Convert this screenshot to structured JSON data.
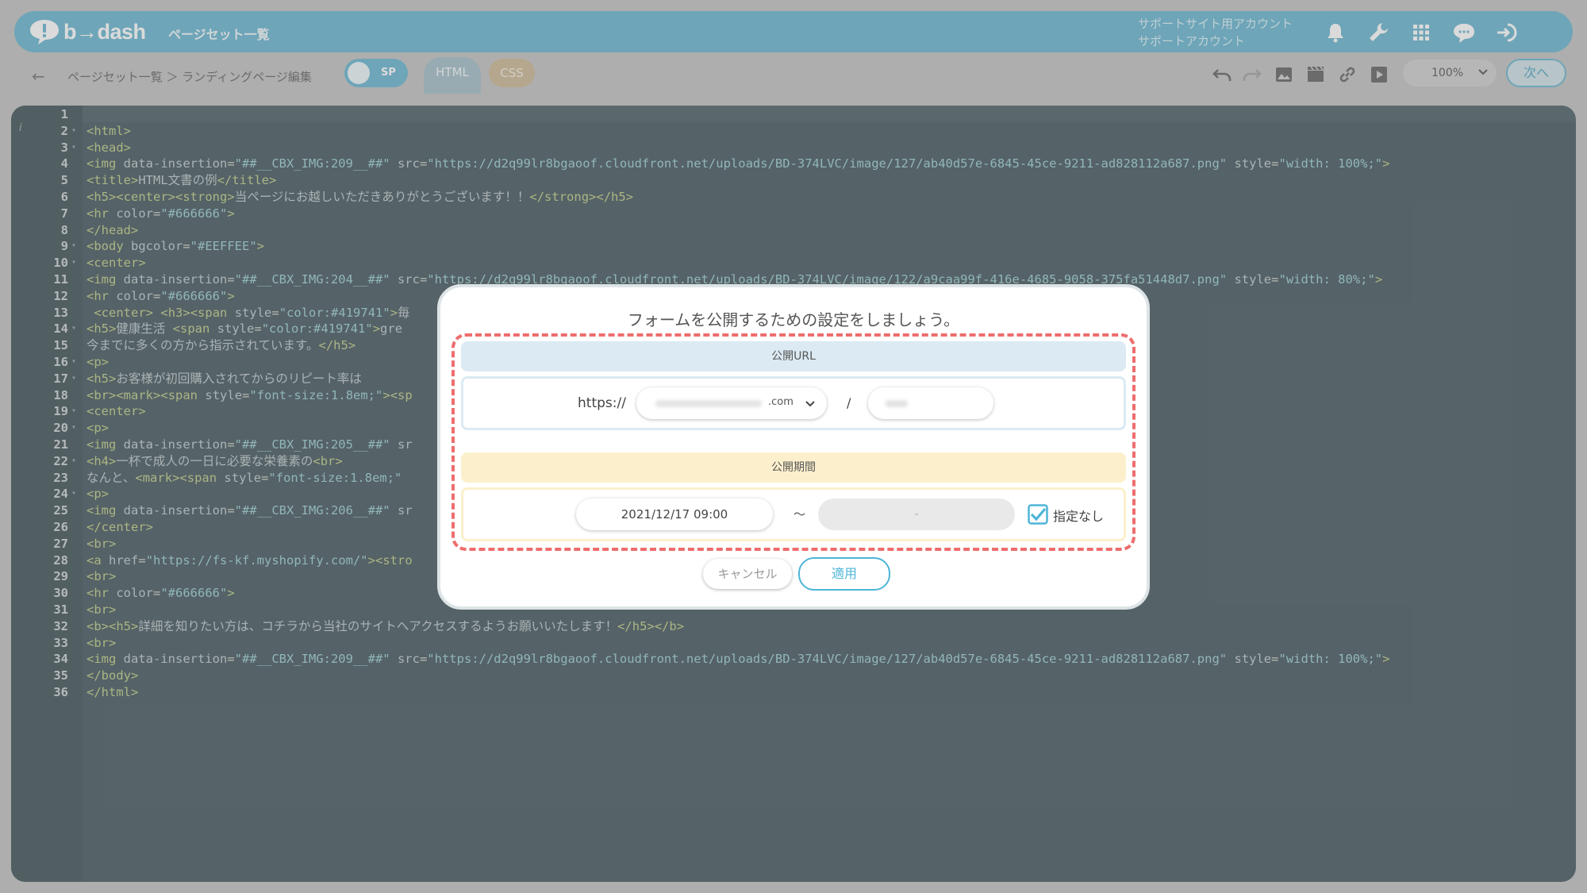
{
  "header": {
    "logo_text": "b→dash",
    "title": "ページセット一覧",
    "account_line1": "サポートサイト用アカウント",
    "account_line2": "サポートアカウント",
    "icons": [
      "bell-icon",
      "wrench-icon",
      "grid-icon",
      "chat-icon",
      "logout-icon"
    ]
  },
  "toolbar": {
    "breadcrumb": "ページセット一覧 ＞ ランディングページ編集",
    "toggle_label": "SP",
    "tab_html": "HTML",
    "tab_css": "CSS",
    "icons": [
      "undo-icon",
      "redo-icon",
      "image-icon",
      "video-icon",
      "link-icon",
      "play-icon"
    ],
    "zoom": "100%",
    "next_label": "次へ"
  },
  "editor": {
    "lines": [
      {
        "n": "1",
        "fold": false,
        "code": ""
      },
      {
        "n": "2",
        "fold": true,
        "code": "<html>"
      },
      {
        "n": "3",
        "fold": true,
        "code": "<head>"
      },
      {
        "n": "4",
        "fold": false,
        "code": "<img data-insertion=\"##__CBX_IMG:209__##\" src=\"https://d2q99lr8bgaoof.cloudfront.net/uploads/BD-374LVC/image/127/ab40d57e-6845-45ce-9211-ad828112a687.png\" style=\"width: 100%;\">"
      },
      {
        "n": "5",
        "fold": false,
        "code": "<title>HTML文書の例</title>"
      },
      {
        "n": "6",
        "fold": false,
        "code": "<h5><center><strong>当ページにお越しいただきありがとうございます！！</strong></h5>"
      },
      {
        "n": "7",
        "fold": false,
        "code": "<hr color=\"#666666\">"
      },
      {
        "n": "8",
        "fold": false,
        "code": "</head>"
      },
      {
        "n": "9",
        "fold": true,
        "code": "<body bgcolor=\"#EEFFEE\">"
      },
      {
        "n": "10",
        "fold": true,
        "code": "<center>"
      },
      {
        "n": "11",
        "fold": false,
        "code": "<img data-insertion=\"##__CBX_IMG:204__##\" src=\"https://d2q99lr8bgaoof.cloudfront.net/uploads/BD-374LVC/image/122/a9caa99f-416e-4685-9058-375fa51448d7.png\" style=\"width: 80%;\">"
      },
      {
        "n": "12",
        "fold": false,
        "code": "<hr color=\"#666666\">"
      },
      {
        "n": "13",
        "fold": false,
        "code": " <center> <h3><span style=\"color:#419741\">毎"
      },
      {
        "n": "14",
        "fold": true,
        "code": "<h5>健康生活 <span style=\"color:#419741\">gre"
      },
      {
        "n": "15",
        "fold": false,
        "code": "今までに多くの方から指示されています。</h5>"
      },
      {
        "n": "16",
        "fold": true,
        "code": "<p>"
      },
      {
        "n": "17",
        "fold": true,
        "code": "<h5>お客様が初回購入されてからのリピート率は"
      },
      {
        "n": "18",
        "fold": false,
        "code": "<br><mark><span style=\"font-size:1.8em;\"><sp"
      },
      {
        "n": "19",
        "fold": true,
        "code": "<center>"
      },
      {
        "n": "20",
        "fold": true,
        "code": "<p>"
      },
      {
        "n": "21",
        "fold": false,
        "code": "<img data-insertion=\"##__CBX_IMG:205__##\" sr                                                      7e-996447d48e0c.png\" style=\"width: 80%;\">"
      },
      {
        "n": "22",
        "fold": true,
        "code": "<h4>一杯で成人の一日に必要な栄養素の<br>"
      },
      {
        "n": "23",
        "fold": false,
        "code": "なんと、<mark><span style=\"font-size:1.8em;\""
      },
      {
        "n": "24",
        "fold": true,
        "code": "<p>"
      },
      {
        "n": "25",
        "fold": false,
        "code": "<img data-insertion=\"##__CBX_IMG:206__##\" sr                                                      d8-61cd28ee23b6.png\" style=\"width: 80%;\">"
      },
      {
        "n": "26",
        "fold": false,
        "code": "</center>"
      },
      {
        "n": "27",
        "fold": false,
        "code": "<br>"
      },
      {
        "n": "28",
        "fold": false,
        "code": "<a href=\"https://fs-kf.myshopify.com/\"><stro"
      },
      {
        "n": "29",
        "fold": false,
        "code": "<br>"
      },
      {
        "n": "30",
        "fold": false,
        "code": "<hr color=\"#666666\">"
      },
      {
        "n": "31",
        "fold": false,
        "code": "<br>"
      },
      {
        "n": "32",
        "fold": false,
        "code": "<b><h5>詳細を知りたい方は、コチラから当社のサイトへアクセスするようお願いいたします！</h5></b>"
      },
      {
        "n": "33",
        "fold": false,
        "code": "<br>"
      },
      {
        "n": "34",
        "fold": false,
        "code": "<img data-insertion=\"##__CBX_IMG:209__##\" src=\"https://d2q99lr8bgaoof.cloudfront.net/uploads/BD-374LVC/image/127/ab40d57e-6845-45ce-9211-ad828112a687.png\" style=\"width: 100%;\">"
      },
      {
        "n": "35",
        "fold": false,
        "code": "</body>"
      },
      {
        "n": "36",
        "fold": false,
        "code": "</html>"
      }
    ]
  },
  "modal": {
    "title": "フォームを公開するための設定をしましょう。",
    "url_section_label": "公開URL",
    "url_prefix": "https://",
    "domain_suffix": ".com",
    "slash": "/",
    "period_section_label": "公開期間",
    "start_datetime": "2021/12/17 09:00",
    "range_separator": "～",
    "end_datetime": "-",
    "no_end_label": "指定なし",
    "no_end_checked": true,
    "cancel_label": "キャンセル",
    "apply_label": "適用"
  },
  "colors": {
    "brand": "#5aaecb",
    "editor_bg": "#33484f",
    "dash_border": "#ee6d6d",
    "apply": "#4db5d8"
  }
}
